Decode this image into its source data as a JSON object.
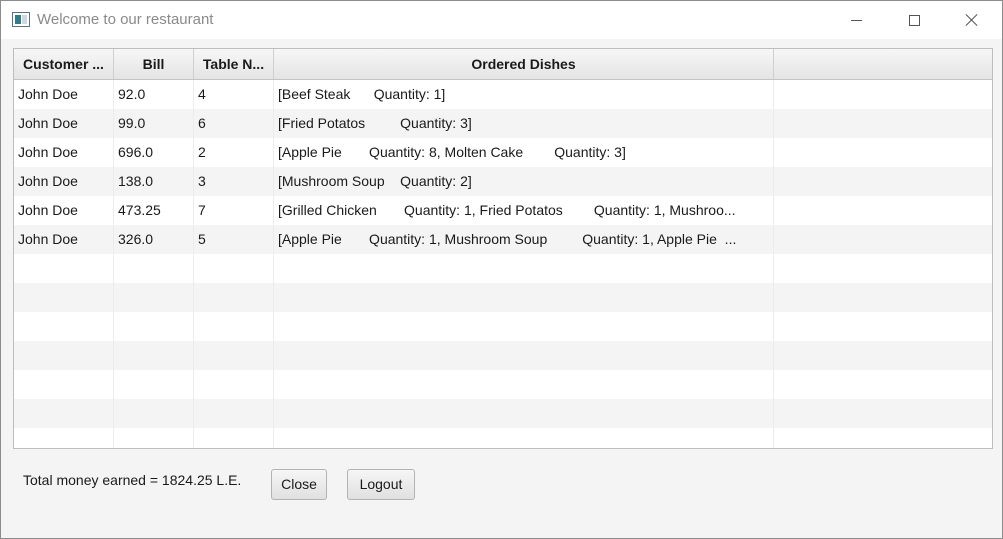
{
  "window": {
    "title": "Welcome to our restaurant",
    "controls": {
      "minimize": "minimize",
      "maximize": "maximize",
      "close": "close"
    }
  },
  "table": {
    "columns": [
      "Customer ...",
      "Bill",
      "Table N...",
      "Ordered Dishes",
      ""
    ],
    "rows": [
      [
        "John Doe",
        "92.0",
        "4",
        "[Beef Steak      Quantity: 1]",
        ""
      ],
      [
        "John Doe",
        "99.0",
        "6",
        "[Fried Potatos         Quantity: 3]",
        ""
      ],
      [
        "John Doe",
        "696.0",
        "2",
        "[Apple Pie       Quantity: 8, Molten Cake        Quantity: 3]",
        ""
      ],
      [
        "John Doe",
        "138.0",
        "3",
        "[Mushroom Soup    Quantity: 2]",
        ""
      ],
      [
        "John Doe",
        "473.25",
        "7",
        "[Grilled Chicken       Quantity: 1, Fried Potatos        Quantity: 1, Mushroo...",
        ""
      ],
      [
        "John Doe",
        "326.0",
        "5",
        "[Apple Pie       Quantity: 1, Mushroom Soup         Quantity: 1, Apple Pie  ...",
        ""
      ],
      [
        "",
        "",
        "",
        "",
        ""
      ],
      [
        "",
        "",
        "",
        "",
        ""
      ],
      [
        "",
        "",
        "",
        "",
        ""
      ],
      [
        "",
        "",
        "",
        "",
        ""
      ],
      [
        "",
        "",
        "",
        "",
        ""
      ],
      [
        "",
        "",
        "",
        "",
        ""
      ],
      [
        "",
        "",
        "",
        "",
        ""
      ]
    ]
  },
  "footer": {
    "total_label": "Total money earned = 1824.25 L.E.",
    "close_label": "Close",
    "logout_label": "Logout"
  }
}
